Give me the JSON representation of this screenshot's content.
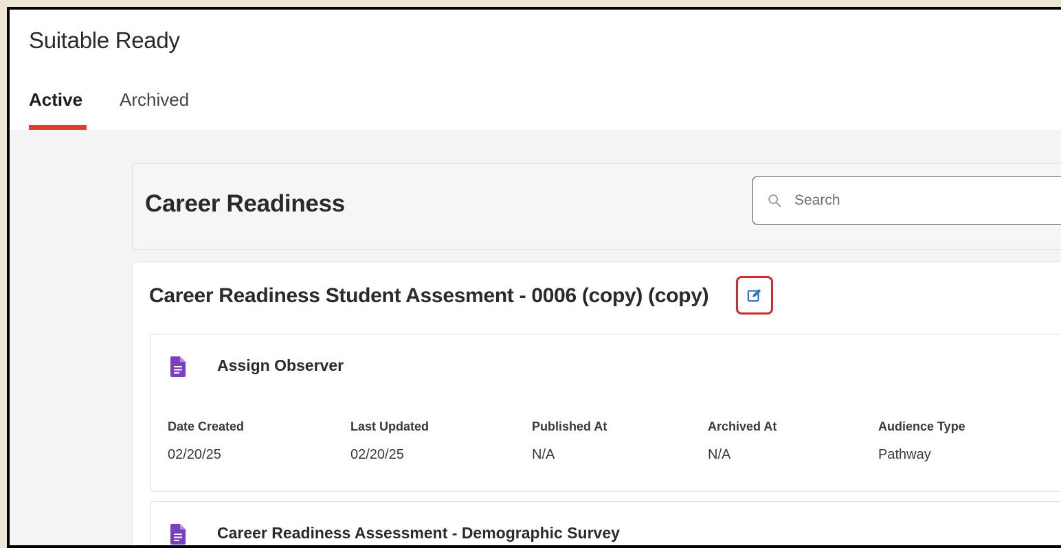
{
  "app": {
    "title": "Suitable Ready"
  },
  "tabs": [
    {
      "label": "Active",
      "active": true
    },
    {
      "label": "Archived",
      "active": false
    }
  ],
  "section": {
    "title": "Career Readiness"
  },
  "search": {
    "placeholder": "Search",
    "value": ""
  },
  "assessment": {
    "title": "Career Readiness Student Assesment - 0006 (copy) (copy)",
    "edit_icon": "edit-icon"
  },
  "surveys": [
    {
      "title": "Assign Observer",
      "icon": "document-icon",
      "fields": [
        {
          "label": "Date Created",
          "value": "02/20/25"
        },
        {
          "label": "Last Updated",
          "value": "02/20/25"
        },
        {
          "label": "Published At",
          "value": "N/A"
        },
        {
          "label": "Archived At",
          "value": "N/A"
        },
        {
          "label": "Audience Type",
          "value": "Pathway"
        }
      ]
    },
    {
      "title": "Career Readiness Assessment - Demographic Survey",
      "icon": "document-icon"
    }
  ],
  "colors": {
    "accent": "#e23a2e",
    "highlight_border": "#cf2b2b",
    "edit_icon": "#2f6fc4",
    "doc_icon": "#7a3fc2"
  }
}
